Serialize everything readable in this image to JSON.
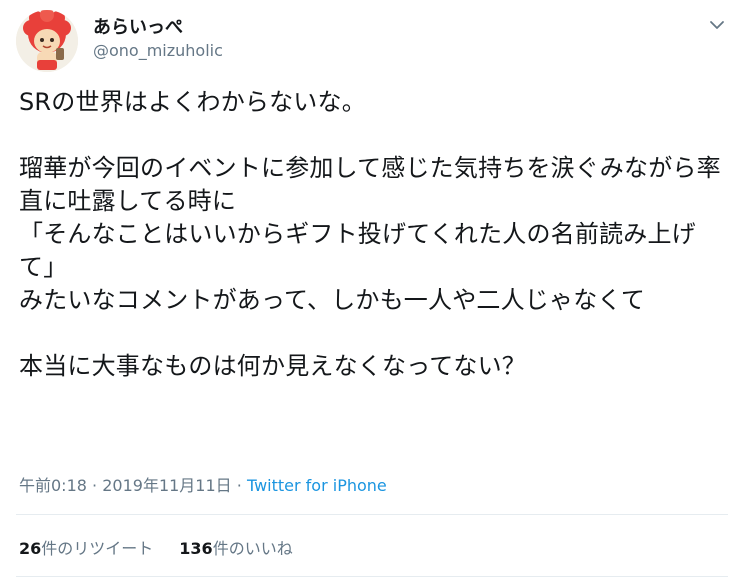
{
  "user": {
    "display_name": "あらいっぺ",
    "screen_name": "@ono_mizuholic"
  },
  "tweet": {
    "text": "SRの世界はよくわからないな。\n\n瑠華が今回のイベントに参加して感じた気持ちを涙ぐみながら率直に吐露してる時に\n「そんなことはいいからギフト投げてくれた人の名前読み上げて」\nみたいなコメントがあって、しかも一人や二人じゃなくて\n\n本当に大事なものは何か見えなくなってない？"
  },
  "meta": {
    "time": "午前0:18",
    "separator": "·",
    "date": "2019年11月11日",
    "source": "Twitter for iPhone"
  },
  "stats": {
    "retweet_count": "26",
    "retweet_label": "件のリツイート",
    "like_count": "136",
    "like_label": "件のいいね"
  },
  "icons": {
    "avatar": "mascot-avatar",
    "caret": "chevron-down-icon"
  },
  "colors": {
    "text": "#14171a",
    "secondary": "#657786",
    "link": "#1b95e0",
    "divider": "#e6ecf0"
  }
}
